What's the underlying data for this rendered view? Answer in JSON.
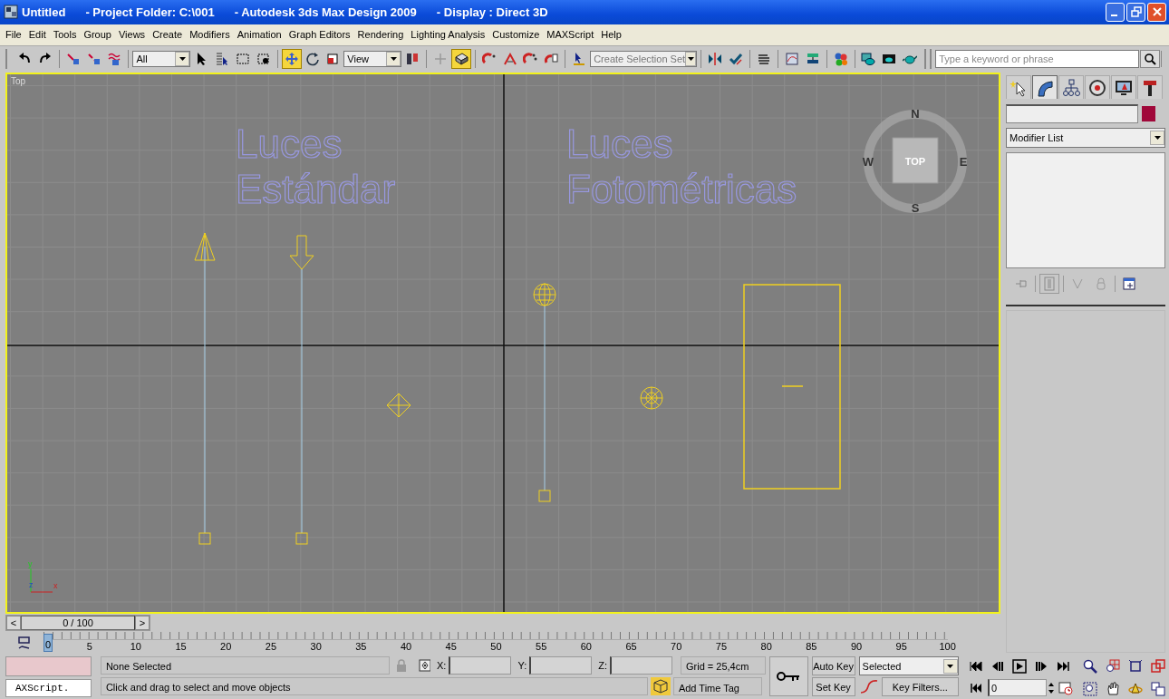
{
  "window": {
    "title_parts": [
      "Untitled",
      "- Project Folder: C:\\001",
      "- Autodesk 3ds Max Design 2009",
      "- Display : Direct 3D"
    ]
  },
  "menu": [
    "File",
    "Edit",
    "Tools",
    "Group",
    "Views",
    "Create",
    "Modifiers",
    "Animation",
    "Graph Editors",
    "Rendering",
    "Lighting Analysis",
    "Customize",
    "MAXScript",
    "Help"
  ],
  "toolbar": {
    "groups": [
      [
        {
          "kind": "tool",
          "selected": false
        },
        {
          "kind": "tool",
          "selected": false
        }
      ],
      [
        {
          "kind": "tool",
          "selected": false
        },
        {
          "kind": "tool",
          "selected": false
        },
        {
          "kind": "tool",
          "selected": false
        }
      ],
      [
        {
          "kind": "dropdown",
          "value": "All"
        },
        {
          "kind": "tool",
          "selected": false
        },
        {
          "kind": "tool",
          "selected": false
        },
        {
          "kind": "tool",
          "selected": false
        },
        {
          "kind": "tool",
          "selected": false
        }
      ],
      [
        {
          "kind": "tool",
          "selected": true
        },
        {
          "kind": "tool",
          "selected": false
        },
        {
          "kind": "tool",
          "selected": false
        },
        {
          "kind": "dropdown",
          "value": "View"
        },
        {
          "kind": "tool",
          "selected": false
        }
      ],
      [
        {
          "kind": "tool",
          "selected": false
        },
        {
          "kind": "tool",
          "selected": true
        }
      ],
      [
        {
          "kind": "tool",
          "selected": false
        },
        {
          "kind": "tool",
          "selected": false
        },
        {
          "kind": "tool",
          "selected": false
        },
        {
          "kind": "tool",
          "selected": false
        }
      ],
      [
        {
          "kind": "tool",
          "selected": false
        },
        {
          "kind": "dropdown",
          "placeholder": "Create Selection Set"
        }
      ],
      [
        {
          "kind": "tool",
          "selected": false
        },
        {
          "kind": "tool",
          "selected": false
        }
      ],
      [
        {
          "kind": "tool",
          "selected": false
        }
      ],
      [
        {
          "kind": "tool",
          "selected": false
        },
        {
          "kind": "tool",
          "selected": false
        }
      ],
      [
        {
          "kind": "tool",
          "selected": false
        }
      ],
      [
        {
          "kind": "tool",
          "selected": false
        },
        {
          "kind": "tool",
          "selected": false
        },
        {
          "kind": "tool",
          "selected": false
        }
      ]
    ],
    "search": {
      "placeholder": "Type a keyword or phrase"
    }
  },
  "viewport": {
    "label": "Top",
    "active": true,
    "titles": [
      {
        "lines": [
          "Luces",
          "Estándar"
        ]
      },
      {
        "lines": [
          "Luces",
          "Fotométricas"
        ]
      }
    ],
    "viewcube": {
      "face": "TOP",
      "north": "N",
      "south": "S",
      "east": "E",
      "west": "W"
    },
    "axes": {
      "x": "x",
      "y": "y",
      "z": "z"
    }
  },
  "command_panel": {
    "tabs": [
      {
        "selected": false
      },
      {
        "selected": true
      },
      {
        "selected": false
      },
      {
        "selected": false
      },
      {
        "selected": false
      },
      {
        "selected": false
      }
    ],
    "modifier_list": "Modifier List"
  },
  "time_slider": {
    "prev": "<",
    "position": "0 / 100",
    "next": ">"
  },
  "track_bar": {
    "labels": [
      "0",
      "5",
      "10",
      "15",
      "20",
      "25",
      "30",
      "35",
      "40",
      "45",
      "50",
      "55",
      "60",
      "65",
      "70",
      "75",
      "80",
      "85",
      "90",
      "95",
      "100"
    ]
  },
  "status": {
    "listener_input": "AXScript.",
    "selection": "None Selected",
    "coords": [
      "X:",
      "Y:",
      "Z:"
    ],
    "grid": "Grid = 25,4cm",
    "prompt": "Click and drag to select and move objects",
    "add_time_tag": "Add Time Tag",
    "auto_key": {
      "label": "Auto Key",
      "on": false
    },
    "set_key": "Set Key",
    "key_set": "Selected",
    "key_filters": "Key Filters...",
    "frame": "0"
  }
}
